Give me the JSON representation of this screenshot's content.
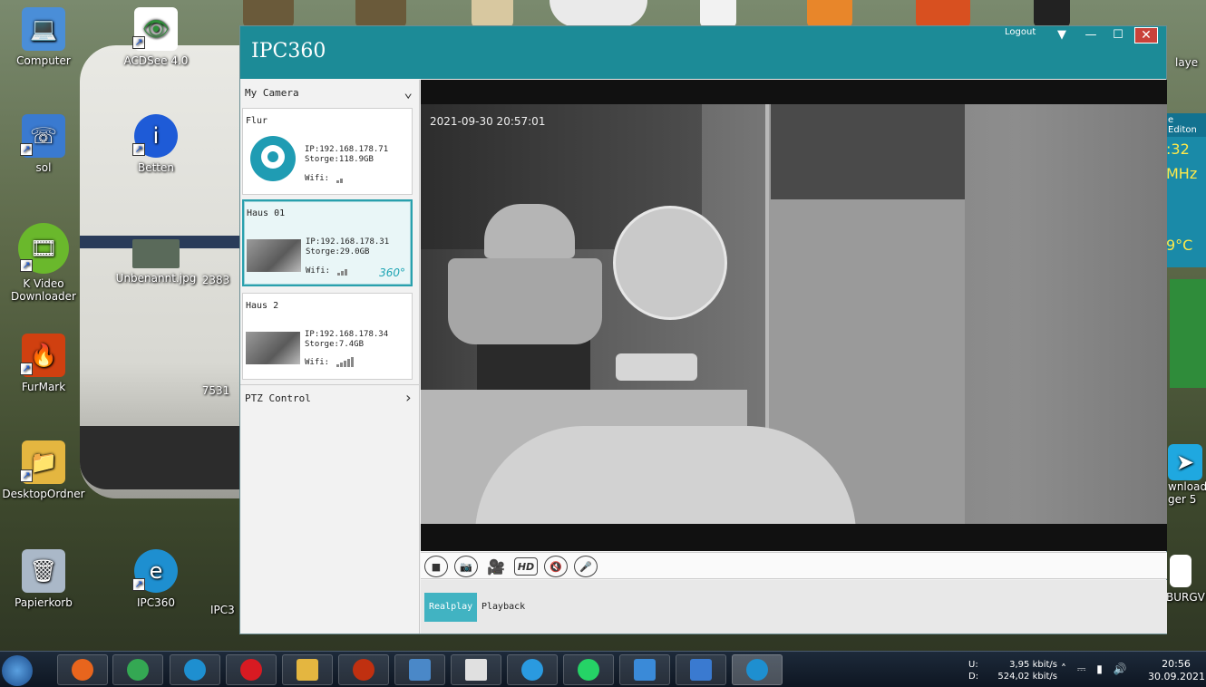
{
  "desktop": {
    "icons": [
      {
        "label": "Computer",
        "icon": "computer-icon",
        "color": "#4a8ed8"
      },
      {
        "label": "ACDSee 4.0",
        "icon": "eye-icon",
        "color": "#2f8f3a"
      },
      {
        "label": "sol",
        "icon": "phone-icon",
        "color": "#3a7ad0"
      },
      {
        "label": "Betten",
        "icon": "info-icon",
        "color": "#1e5bd7"
      },
      {
        "label": "K Video Downloader",
        "icon": "film-icon",
        "color": "#6ab82c"
      },
      {
        "label": "Unbenannt.jpg",
        "icon": "image-icon",
        "color": "#5a6a5a"
      },
      {
        "label": "2383",
        "icon": "image-icon",
        "color": "#5a6a5a"
      },
      {
        "label": "FurMark",
        "icon": "fire-icon",
        "color": "#d04010"
      },
      {
        "label": "7531",
        "icon": "image-icon",
        "color": "#5a6a5a"
      },
      {
        "label": "DesktopOrdner",
        "icon": "folder-icon",
        "color": "#e4b640"
      },
      {
        "label": "Papierkorb",
        "icon": "trash-icon",
        "color": "#aab8c8"
      },
      {
        "label": "IPC360",
        "icon": "ipc360-icon",
        "color": "#1e8fd0"
      },
      {
        "label": "IPC3",
        "icon": "ipc360-icon",
        "color": "#1e8fd0"
      }
    ],
    "right_edge": {
      "labels": [
        "laye",
        "e Editon",
        ":32",
        "MHz",
        "9°C",
        "wnload",
        "ger 5",
        "BURGVI"
      ]
    }
  },
  "window": {
    "title": "IPC360",
    "logout": "Logout",
    "controls": {
      "minimize": "—",
      "maximize": "☐",
      "close": "✕"
    }
  },
  "sidebar": {
    "my_camera": "My Camera",
    "ptz": "PTZ Control",
    "cameras": [
      {
        "name": "Flur",
        "ip": "IP:192.168.178.71",
        "storage": "Storge:118.9GB",
        "wifi": "Wifi:",
        "signal": 2,
        "active": false
      },
      {
        "name": "Haus 01",
        "ip": "IP:192.168.178.31",
        "storage": "Storge:29.0GB",
        "wifi": "Wifi:",
        "signal": 3,
        "active": true,
        "badge": "360°"
      },
      {
        "name": "Haus 2",
        "ip": "IP:192.168.178.34",
        "storage": "Storge:7.4GB",
        "wifi": "Wifi:",
        "signal": 5,
        "active": false
      }
    ]
  },
  "video": {
    "timestamp": "2021-09-30 20:57:01",
    "toolbar": {
      "hd": "HD"
    }
  },
  "tabs": {
    "realplay": "Realplay",
    "playback": "Playback"
  },
  "taskbar": {
    "apps": [
      {
        "icon": "firefox-icon",
        "color": "#e8651d"
      },
      {
        "icon": "chrome-icon",
        "color": "#34a853"
      },
      {
        "icon": "ie-icon",
        "color": "#1e8fd0"
      },
      {
        "icon": "opera-icon",
        "color": "#d81a22"
      },
      {
        "icon": "explorer-icon",
        "color": "#e4b640"
      },
      {
        "icon": "furmark-icon",
        "color": "#c03010"
      },
      {
        "icon": "store-icon",
        "color": "#4a88c8"
      },
      {
        "icon": "calc-icon",
        "color": "#e0e0e0"
      },
      {
        "icon": "smiley-icon",
        "color": "#2a9ae0"
      },
      {
        "icon": "whatsapp-icon",
        "color": "#25d366"
      },
      {
        "icon": "monitor-icon",
        "color": "#3a8ad8"
      },
      {
        "icon": "phone-icon",
        "color": "#3a7ad0"
      },
      {
        "icon": "ipc360-icon",
        "color": "#1e8fd0"
      }
    ],
    "net_up_label": "U:",
    "net_down_label": "D:",
    "net_up": "3,95 kbit/s",
    "net_down": "524,02 kbit/s",
    "time": "20:56",
    "date": "30.09.2021"
  },
  "colors": {
    "accent": "#1c8b97",
    "active_tab": "#41b3c2"
  }
}
